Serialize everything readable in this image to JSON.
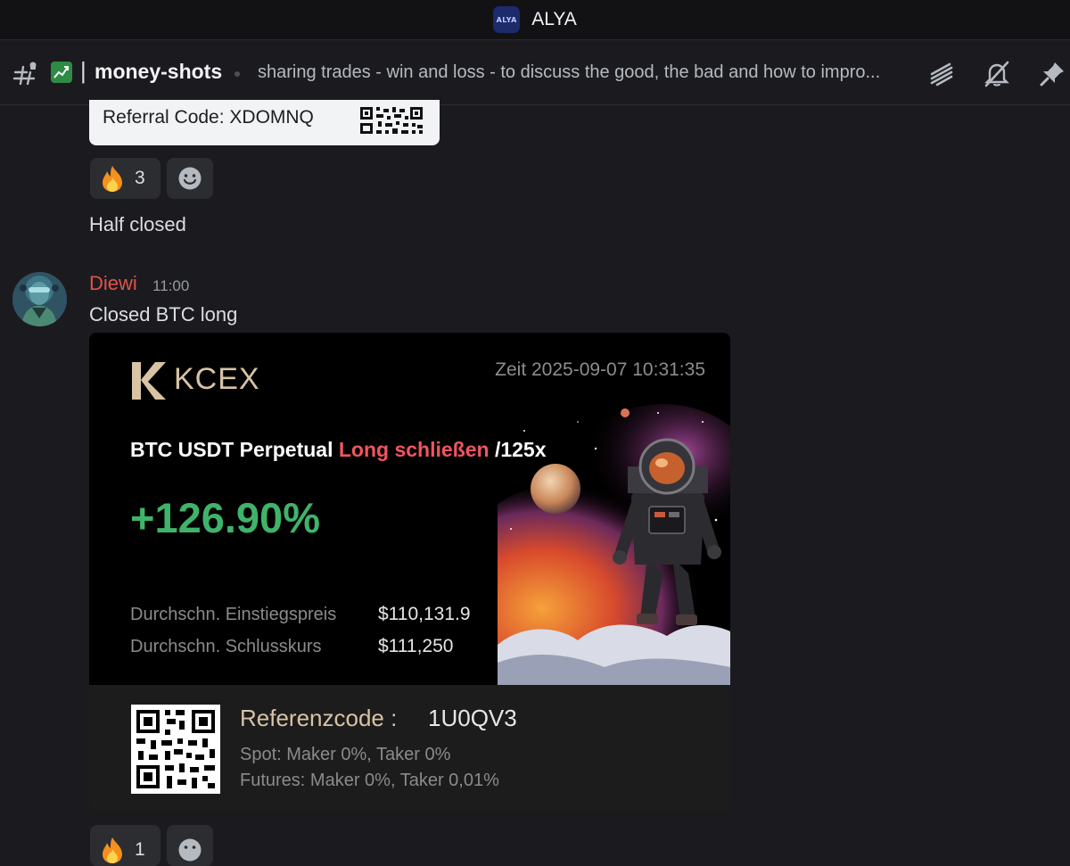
{
  "server": {
    "badge": "ALYA",
    "name": "ALYA"
  },
  "channel": {
    "separator": "|",
    "name": "money-shots",
    "topic": "sharing trades - win and loss - to discuss the good, the bad and how to impro..."
  },
  "prev_embed": {
    "referral": "Referral Code: XDOMNQ"
  },
  "reactions_1": {
    "fire_count": "3"
  },
  "messages": {
    "half_closed": "Half closed",
    "author": "Diewi",
    "time": "11:00",
    "text": "Closed BTC long"
  },
  "trade_card": {
    "brand": "KCEX",
    "zeit": "Zeit 2025-09-07 10:31:35",
    "pair": "BTC USDT Perpetual ",
    "side": "Long schließen",
    "leverage": " /125x",
    "pnl": "+126.90%",
    "entry_label": "Durchschn. Einstiegspreis",
    "entry_value": "$110,131.9",
    "close_label": "Durchschn. Schlusskurs",
    "close_value": "$111,250",
    "refcode_label": "Referenzcode :",
    "refcode_value": "1U0QV3",
    "spot_fee": "Spot: Maker 0%, Taker 0%",
    "futures_fee": "Futures: Maker 0%, Taker 0,01%"
  },
  "reactions_2": {
    "fire_count": "1"
  },
  "icons": {
    "hash": "hash-icon",
    "chart_emoji": "chart-increasing-icon",
    "threads": "threads-icon",
    "mute": "bell-muted-icon",
    "pin": "pin-icon",
    "fire": "fire-icon",
    "add_reaction": "add-reaction-icon"
  },
  "colors": {
    "background": "#1b1b1f",
    "author": "#e0534a",
    "profit": "#3fb36a",
    "side": "#f0555f",
    "brand": "#d8c3a5"
  }
}
